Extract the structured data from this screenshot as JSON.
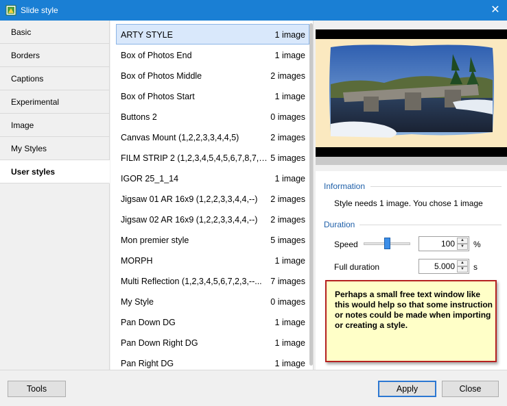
{
  "window": {
    "title": "Slide style",
    "icon": "slide-style-app-icon",
    "close_icon": "close-icon"
  },
  "sidebar": {
    "items": [
      {
        "label": "Basic"
      },
      {
        "label": "Borders"
      },
      {
        "label": "Captions"
      },
      {
        "label": "Experimental"
      },
      {
        "label": "Image"
      },
      {
        "label": "My Styles"
      },
      {
        "label": "User styles",
        "selected": true
      }
    ]
  },
  "styles_list": {
    "items": [
      {
        "name": "ARTY STYLE",
        "count": "1 image",
        "selected": true
      },
      {
        "name": "Box of Photos End",
        "count": "1 image"
      },
      {
        "name": "Box of Photos Middle",
        "count": "2 images"
      },
      {
        "name": "Box of Photos Start",
        "count": "1 image"
      },
      {
        "name": "Buttons 2",
        "count": "0 images"
      },
      {
        "name": "Canvas Mount (1,2,2,3,3,4,4,5)",
        "count": "2 images"
      },
      {
        "name": "FILM STRIP 2 (1,2,3,4,5,4,5,6,7,8,7,8,...",
        "count": "5 images"
      },
      {
        "name": "IGOR 25_1_14",
        "count": "1 image"
      },
      {
        "name": "Jigsaw 01 AR 16x9 (1,2,2,3,3,4,4,--)",
        "count": "2 images"
      },
      {
        "name": "Jigsaw 02 AR 16x9 (1,2,2,3,3,4,4,--)",
        "count": "2 images"
      },
      {
        "name": "Mon premier style",
        "count": "5 images"
      },
      {
        "name": "MORPH",
        "count": "1 image"
      },
      {
        "name": "Multi Reflection (1,2,3,4,5,6,7,2,3,--...",
        "count": "7 images"
      },
      {
        "name": "My Style",
        "count": "0 images"
      },
      {
        "name": "Pan Down DG",
        "count": "1 image"
      },
      {
        "name": "Pan Down Right DG",
        "count": "1 image"
      },
      {
        "name": "Pan Right DG",
        "count": "1 image"
      }
    ]
  },
  "information": {
    "title": "Information",
    "text": "Style needs 1 image. You chose 1 image"
  },
  "duration": {
    "title": "Duration",
    "speed_label": "Speed",
    "speed_value": "100",
    "speed_unit": "%",
    "speed_slider_fraction": 0.5,
    "full_duration_label": "Full duration",
    "full_duration_value": "5.000",
    "full_duration_unit": "s"
  },
  "note": {
    "text": "Perhaps a small free text window like this would help so that some instruction or notes could be made when importing or creating a style."
  },
  "footer": {
    "tools_label": "Tools",
    "apply_label": "Apply",
    "close_label": "Close"
  },
  "colors": {
    "titlebar": "#1a7fd4",
    "section_title": "#1e5fa8",
    "selection": "#d9e8fb",
    "note_border": "#b52020",
    "note_bg": "#ffffc8"
  }
}
